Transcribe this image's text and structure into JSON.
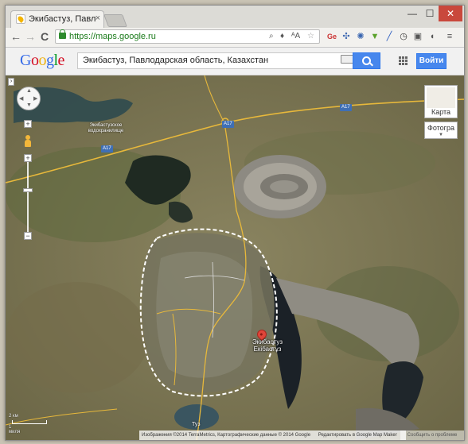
{
  "browser": {
    "tab_title": "Экибастуз, Павлодарская...",
    "tab_close": "×",
    "window_buttons": {
      "minimize": "—",
      "maximize": "☐",
      "close": "✕"
    },
    "nav": {
      "back": "←",
      "forward": "→",
      "reload": "C"
    },
    "url": "https://maps.google.ru",
    "extensions": [
      "search-icon",
      "bulb-icon",
      "translate-icon",
      "star-icon",
      "ge-icon",
      "puzzle-icon",
      "gear-icon",
      "arrow-down-icon",
      "pen-icon",
      "clock-icon",
      "screen-icon",
      "sound-icon",
      "menu-icon"
    ]
  },
  "google_header": {
    "logo": "Google",
    "search_value": "Экибастуз, Павлодарская область, Казахстан",
    "signin_label": "Войти",
    "colors": {
      "accent": "#4787ed"
    }
  },
  "map": {
    "layer_map_label": "Карта",
    "layer_sat_label": "Фотогра",
    "road_label_1": "A17",
    "road_label_2": "A17",
    "road_label_3": "A17",
    "reservoir_label": "Экибастузское водохранилище",
    "city_label_line1": "Экибастуз",
    "city_label_line2": "Екібастұз",
    "lake_label": "Туз",
    "scale_km": "2 км",
    "scale_mi": "1 миля",
    "footer_imagery": "Изображения ©2014 TerraMetrics, Картографические данные © 2014 Google",
    "footer_edit": "Редактировать в Google Map Maker",
    "report_label": "Сообщить о проблеме"
  }
}
